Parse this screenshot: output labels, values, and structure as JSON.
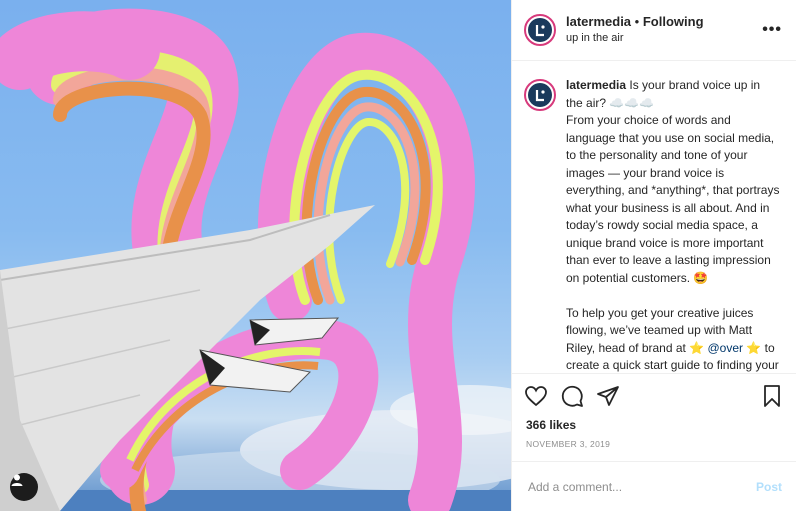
{
  "post": {
    "image_alt": "Airplane wing with rainbow ribbon loops over sky",
    "user_tag_icon": "person-icon"
  },
  "header": {
    "username": "latermedia",
    "separator": "•",
    "follow_status": "Following",
    "location": "up in the air",
    "more_icon": "more-options-icon",
    "more_label": "•••"
  },
  "caption": {
    "username": "latermedia",
    "text": " Is your brand voice up in the air? ☁️☁️☁️\nFrom your choice of words and language that you use on social media, to the personality and tone of your images — your brand voice is everything, and *anything*, that portrays what your business is all about. And in today’s rowdy social media space, a unique brand voice is more important than ever to leave a lasting impression on potential customers. 🤩\n\nTo help you get your creative juices flowing, we’ve teamed up with Matt Riley, head of brand at ⭐ ",
    "mention": "@over",
    "text_after": " ⭐ to create a quick start guide to finding your brand voice and designing Instagram-ready assets that reflect it."
  },
  "actions": {
    "like_icon": "heart-icon",
    "comment_icon": "comment-icon",
    "share_icon": "share-icon",
    "save_icon": "bookmark-icon"
  },
  "likes": "366 likes",
  "date": "NOVEMBER 3, 2019",
  "comment_box": {
    "placeholder": "Add a comment...",
    "post_label": "Post"
  },
  "colors": {
    "ring": "#d73a7c",
    "link": "#00376b",
    "post_disabled": "#b2dffc",
    "ribbon_pink": "#ee86d8",
    "ribbon_yellow": "#e4f56a",
    "ribbon_orange": "#e8914a",
    "ribbon_salmon": "#f2a69a"
  }
}
